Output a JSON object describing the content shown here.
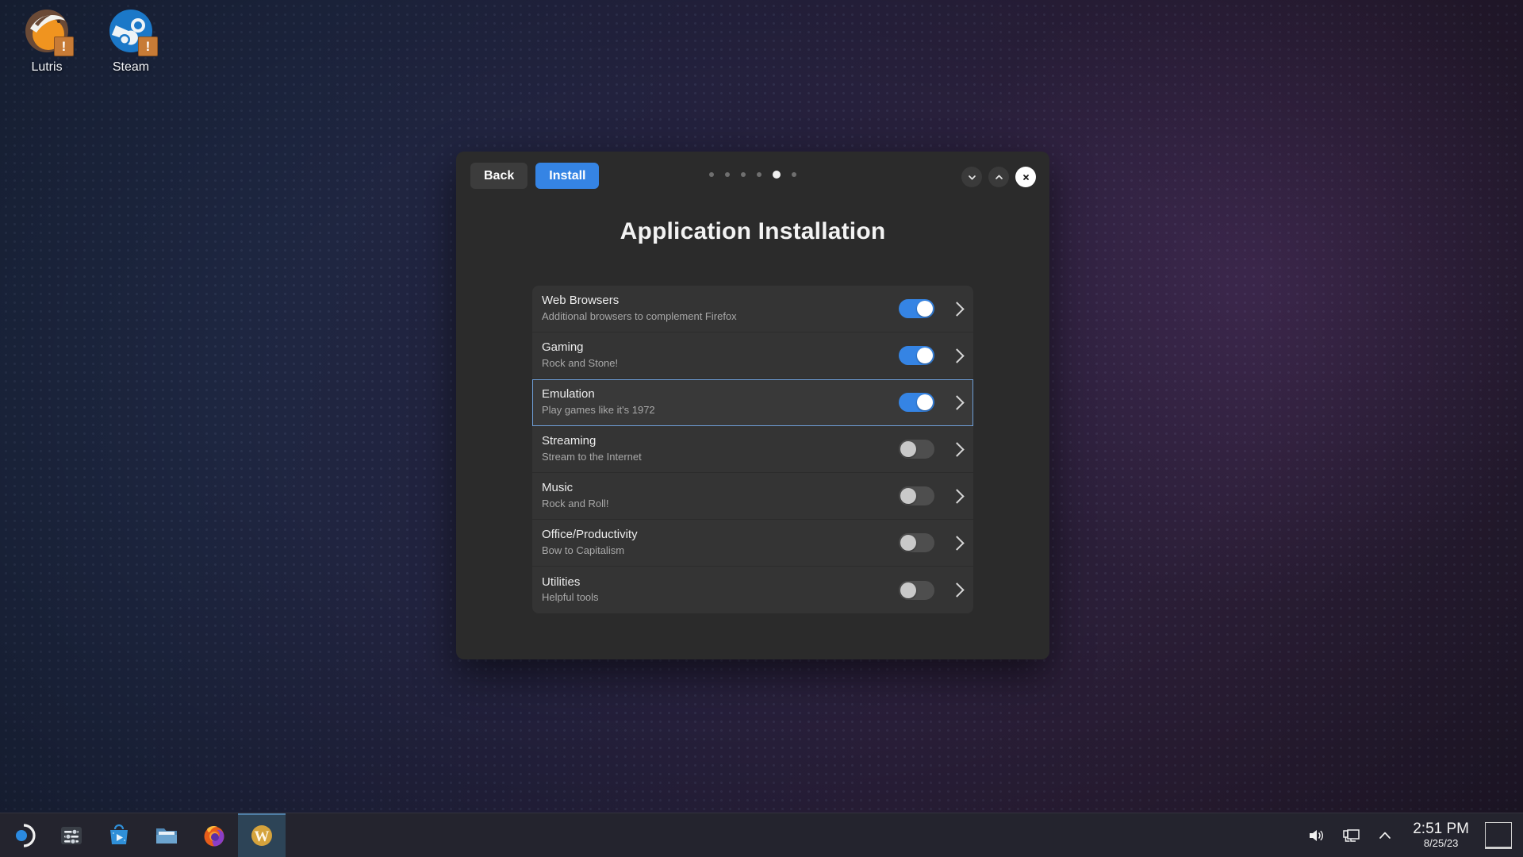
{
  "desktop": {
    "icons": [
      {
        "label": "Lutris",
        "icon": "lutris-icon",
        "badge": "!"
      },
      {
        "label": "Steam",
        "icon": "steam-icon",
        "badge": "!"
      }
    ]
  },
  "dialog": {
    "title": "Application Installation",
    "buttons": {
      "back": "Back",
      "install": "Install"
    },
    "accent_color": "#3584e4",
    "background_color": "#2b2b2b",
    "pagination": {
      "total": 6,
      "active_index": 4
    },
    "window_controls": [
      {
        "name": "minimize-icon",
        "glyph": "chevron-down"
      },
      {
        "name": "maximize-icon",
        "glyph": "chevron-up"
      },
      {
        "name": "close-icon",
        "glyph": "x"
      }
    ],
    "categories": [
      {
        "name": "Web Browsers",
        "description": "Additional browsers to complement Firefox",
        "enabled": true,
        "selected": false
      },
      {
        "name": "Gaming",
        "description": "Rock and Stone!",
        "enabled": true,
        "selected": false
      },
      {
        "name": "Emulation",
        "description": "Play games like it's 1972",
        "enabled": true,
        "selected": true
      },
      {
        "name": "Streaming",
        "description": "Stream to the Internet",
        "enabled": false,
        "selected": false
      },
      {
        "name": "Music",
        "description": "Rock and Roll!",
        "enabled": false,
        "selected": false
      },
      {
        "name": "Office/Productivity",
        "description": "Bow to Capitalism",
        "enabled": false,
        "selected": false
      },
      {
        "name": "Utilities",
        "description": "Helpful tools",
        "enabled": false,
        "selected": false
      }
    ]
  },
  "taskbar": {
    "apps": [
      {
        "name": "app-launcher-icon",
        "label": "Application Launcher",
        "active": false
      },
      {
        "name": "settings-icon",
        "label": "System Settings",
        "active": false
      },
      {
        "name": "software-store-icon",
        "label": "Software Store",
        "active": false
      },
      {
        "name": "file-manager-icon",
        "label": "File Manager",
        "active": false
      },
      {
        "name": "firefox-icon",
        "label": "Firefox",
        "active": false
      },
      {
        "name": "installer-icon",
        "label": "W",
        "active": true
      }
    ],
    "tray": {
      "volume_icon": "volume-icon",
      "display_icon": "display-icon",
      "overflow_icon": "chevron-up-icon",
      "time": "2:51 PM",
      "date": "8/25/23",
      "show_desktop_label": "Show Desktop"
    }
  }
}
